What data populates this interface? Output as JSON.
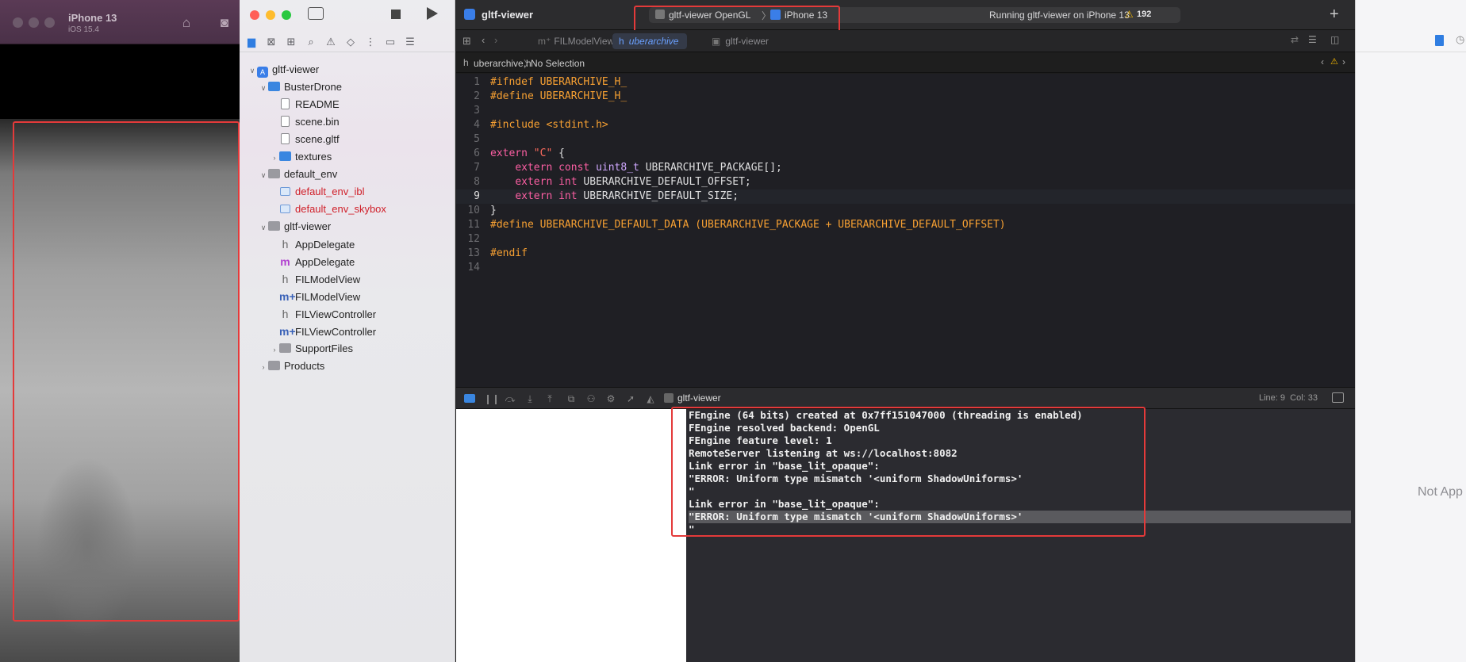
{
  "simulator": {
    "device": "iPhone 13",
    "os": "iOS 15.4"
  },
  "toolbar": {
    "app_title": "gltf-viewer",
    "scheme": "gltf-viewer OpenGL",
    "destination": "iPhone 13",
    "status": "Running gltf-viewer on iPhone 13",
    "warning_count": "192"
  },
  "tabs": [
    {
      "label": "FILModelView"
    },
    {
      "label": "uberarchive"
    },
    {
      "label": "gltf-viewer"
    }
  ],
  "jump_bar": {
    "file": "uberarchive.h",
    "selection": "No Selection"
  },
  "navigator": {
    "items": [
      {
        "label": "gltf-viewer"
      },
      {
        "label": "BusterDrone"
      },
      {
        "label": "README"
      },
      {
        "label": "scene.bin"
      },
      {
        "label": "scene.gltf"
      },
      {
        "label": "textures"
      },
      {
        "label": "default_env"
      },
      {
        "label": "default_env_ibl"
      },
      {
        "label": "default_env_skybox"
      },
      {
        "label": "gltf-viewer"
      },
      {
        "label": "AppDelegate"
      },
      {
        "label": "AppDelegate"
      },
      {
        "label": "FILModelView"
      },
      {
        "label": "FILModelView"
      },
      {
        "label": "FILViewController"
      },
      {
        "label": "FILViewController"
      },
      {
        "label": "SupportFiles"
      },
      {
        "label": "Products"
      }
    ]
  },
  "editor": {
    "line_numbers": [
      "1",
      "2",
      "3",
      "4",
      "5",
      "6",
      "7",
      "8",
      "9",
      "10",
      "11",
      "12",
      "13",
      "14"
    ],
    "lines": {
      "l1a": "#ifndef",
      "l1b": " UBERARCHIVE_H_",
      "l2a": "#define",
      "l2b": " UBERARCHIVE_H_",
      "l4a": "#include",
      "l4b": " <stdint.h>",
      "l6a": "extern",
      "l6b": " \"C\"",
      "l6c": " {",
      "l7a": "extern",
      "l7b": " const",
      "l7c": " uint8_t",
      "l7d": " UBERARCHIVE_PACKAGE[];",
      "l8a": "extern",
      "l8b": " int",
      "l8c": " UBERARCHIVE_DEFAULT_OFFSET;",
      "l9a": "extern",
      "l9b": " int",
      "l9c": " UBERARCHIVE_DEFAULT_SIZE;",
      "l10a": "}",
      "l11a": "#define",
      "l11b": " UBERARCHIVE_DEFAULT_DATA (UBERARCHIVE_PACKAGE + UBERARCHIVE_DEFAULT_OFFSET)",
      "l13a": "#endif"
    }
  },
  "debug_bar": {
    "target": "gltf-viewer",
    "position": "Line: 9  Col: 33"
  },
  "console": {
    "lines": [
      "FEngine (64 bits) created at 0x7ff151047000 (threading is enabled)",
      "FEngine resolved backend: OpenGL",
      "FEngine feature level: 1",
      "RemoteServer listening at ws://localhost:8082",
      "Link error in \"base_lit_opaque\":",
      "\"ERROR: Uniform type mismatch '<uniform ShadowUniforms>'",
      "\"",
      "Link error in \"base_lit_opaque\":",
      "\"ERROR: Uniform type mismatch '<uniform ShadowUniforms>'",
      "\""
    ]
  },
  "inspector": {
    "message": "Not App"
  },
  "colors": {
    "highlight_box": "#e43a3a",
    "accent": "#3a86e0",
    "warning": "#f5b800"
  }
}
